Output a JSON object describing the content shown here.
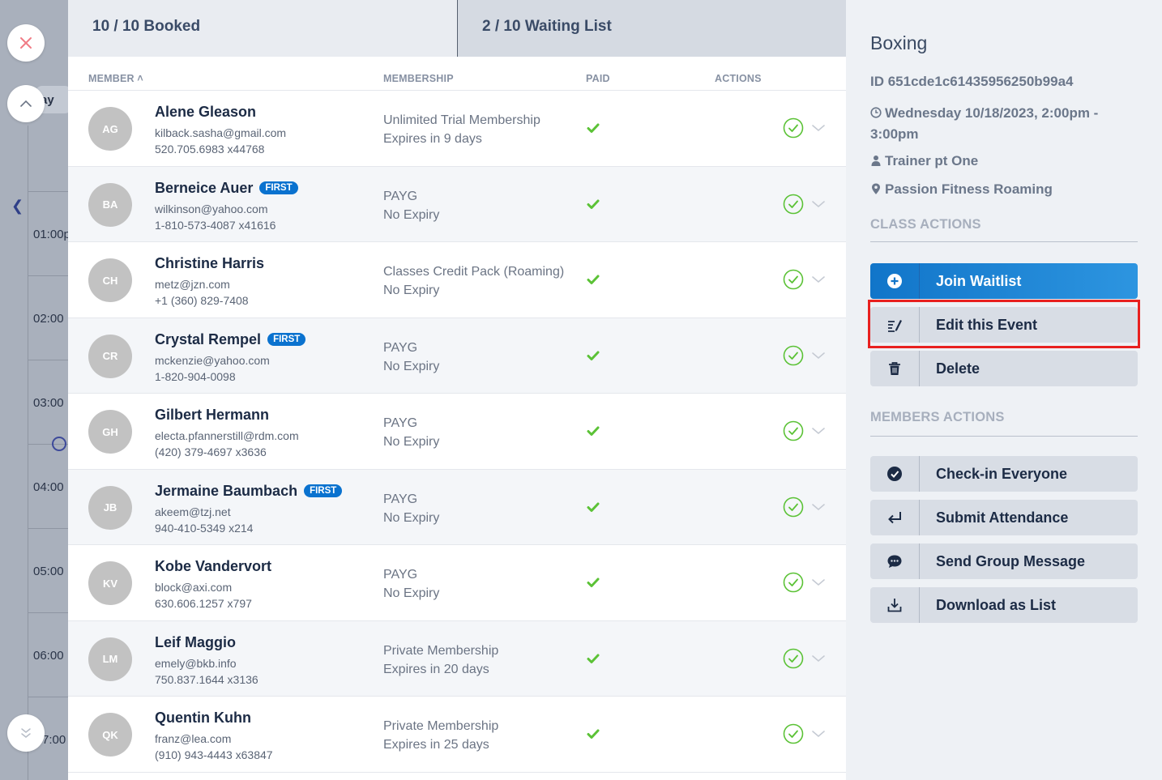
{
  "background": {
    "tab_day": "ay",
    "times": [
      "01:00p",
      "02:00",
      "03:00",
      "04:00",
      "05:00",
      "06:00",
      "7:00"
    ]
  },
  "tabs": {
    "booked": "10 / 10 Booked",
    "waiting": "2 / 10 Waiting List"
  },
  "table": {
    "headers": {
      "member": "MEMBER ˄",
      "membership": "MEMBERSHIP",
      "paid": "PAID",
      "actions": "ACTIONS"
    },
    "rows": [
      {
        "initials": "AG",
        "name": "Alene Gleason",
        "badge": "",
        "email": "kilback.sasha@gmail.com",
        "phone": "520.705.6983 x44768",
        "membership": "Unlimited Trial Membership",
        "expiry": "Expires in 9 days"
      },
      {
        "initials": "BA",
        "name": "Berneice Auer",
        "badge": "FIRST",
        "email": "wilkinson@yahoo.com",
        "phone": "1-810-573-4087 x41616",
        "membership": "PAYG",
        "expiry": "No Expiry"
      },
      {
        "initials": "CH",
        "name": "Christine Harris",
        "badge": "",
        "email": "metz@jzn.com",
        "phone": "+1 (360) 829-7408",
        "membership": "Classes Credit Pack (Roaming)",
        "expiry": "No Expiry"
      },
      {
        "initials": "CR",
        "name": "Crystal Rempel",
        "badge": "FIRST",
        "email": "mckenzie@yahoo.com",
        "phone": "1-820-904-0098",
        "membership": "PAYG",
        "expiry": "No Expiry"
      },
      {
        "initials": "GH",
        "name": "Gilbert Hermann",
        "badge": "",
        "email": "electa.pfannerstill@rdm.com",
        "phone": "(420) 379-4697 x3636",
        "membership": "PAYG",
        "expiry": "No Expiry"
      },
      {
        "initials": "JB",
        "name": "Jermaine Baumbach",
        "badge": "FIRST",
        "email": "akeem@tzj.net",
        "phone": "940-410-5349 x214",
        "membership": "PAYG",
        "expiry": "No Expiry"
      },
      {
        "initials": "KV",
        "name": "Kobe Vandervort",
        "badge": "",
        "email": "block@axi.com",
        "phone": "630.606.1257 x797",
        "membership": "PAYG",
        "expiry": "No Expiry"
      },
      {
        "initials": "LM",
        "name": "Leif Maggio",
        "badge": "",
        "email": "emely@bkb.info",
        "phone": "750.837.1644 x3136",
        "membership": "Private Membership",
        "expiry": "Expires in 20 days"
      },
      {
        "initials": "QK",
        "name": "Quentin Kuhn",
        "badge": "",
        "email": "franz@lea.com",
        "phone": "(910) 943-4443 x63847",
        "membership": "Private Membership",
        "expiry": "Expires in 25 days"
      }
    ]
  },
  "side": {
    "title": "Boxing",
    "id": "ID 651cde1c61435956250b99a4",
    "date": "Wednesday 10/18/2023, 2:00pm - 3:00pm",
    "trainer": "Trainer pt One",
    "location": "Passion Fitness Roaming",
    "class_actions_label": "CLASS ACTIONS",
    "members_actions_label": "MEMBERS ACTIONS",
    "class_actions": [
      {
        "label": "Join Waitlist",
        "icon": "plus-circle-icon"
      },
      {
        "label": "Edit this Event",
        "icon": "edit-pen-icon"
      },
      {
        "label": "Delete",
        "icon": "trash-icon"
      }
    ],
    "member_actions": [
      {
        "label": "Check-in Everyone",
        "icon": "check-circle-icon"
      },
      {
        "label": "Submit Attendance",
        "icon": "enter-arrow-icon"
      },
      {
        "label": "Send Group Message",
        "icon": "chat-bubble-icon"
      },
      {
        "label": "Download as List",
        "icon": "download-icon"
      }
    ]
  },
  "colors": {
    "accent": "#1175c9",
    "badge": "#0a72cf",
    "paid_green": "#5bc236",
    "highlight": "#e8201f"
  }
}
